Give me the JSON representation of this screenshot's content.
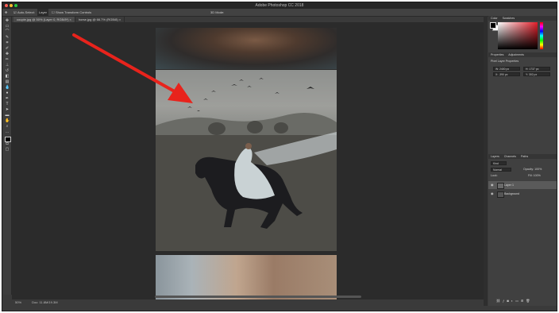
{
  "app": {
    "title": "Adobe Photoshop CC 2018"
  },
  "options_bar": {
    "auto_select": "Auto-Select:",
    "auto_select_target": "Layer",
    "show_transform": "Show Transform Controls",
    "mode_3d": "3D Mode:"
  },
  "tabs": [
    {
      "label": "couple.jpg @ 50% (Layer 0, RGB/8*) ×"
    },
    {
      "label": "horse.jpg @ 66.7% (RGB/8) ×"
    }
  ],
  "status": {
    "zoom": "50%",
    "doc": "Doc: 11.8M/19.3M"
  },
  "panels": {
    "color_tab": "Color",
    "swatches_tab": "Swatches",
    "properties_tab": "Properties",
    "adjustments_tab": "Adjustments",
    "pixel_layer": "Pixel Layer Properties",
    "w": "W: 2400 px",
    "h": "H: 1737 px",
    "x": "X: -390 px",
    "y": "Y: 302 px",
    "layers_tab": "Layers",
    "channels_tab": "Channels",
    "paths_tab": "Paths",
    "kind": "Kind",
    "blend": "Normal",
    "opacity": "Opacity: 100%",
    "lock": "Lock:",
    "fill": "Fill: 100%",
    "layers": [
      {
        "name": "Layer 1",
        "selected": true
      },
      {
        "name": "Background",
        "selected": false
      }
    ]
  },
  "annotation": {
    "arrow_color": "#e8231c"
  },
  "colors": {
    "fg": "#000000",
    "bg": "#ffffff"
  }
}
